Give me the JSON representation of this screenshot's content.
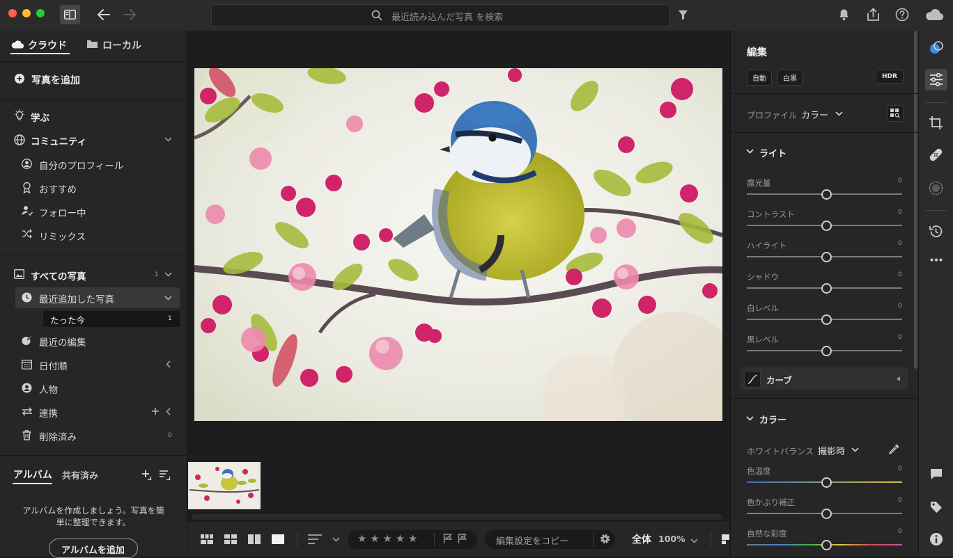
{
  "search": {
    "placeholder": "最近読み込んだ写真 を検索"
  },
  "sidebar": {
    "tabs": {
      "cloud": "クラウド",
      "local": "ローカル"
    },
    "add_photos": "写真を追加",
    "learn": "学ぶ",
    "community": "コミュニティ",
    "community_items": [
      "自分のプロフィール",
      "おすすめ",
      "フォロー中",
      "リミックス"
    ],
    "all_photos": {
      "label": "すべての写真",
      "count": "1"
    },
    "recent_added": "最近追加した写真",
    "just_now": {
      "label": "たった今",
      "count": "1"
    },
    "recent_edits": "最近の編集",
    "by_date": "日付順",
    "people": "人物",
    "integrations": "連携",
    "deleted": {
      "label": "削除済み",
      "count": "0"
    },
    "albums_tab": "アルバム",
    "shared_tab": "共有済み",
    "album_hint": "アルバムを作成しましょう。写真を簡単に整理できます。",
    "add_album": "アルバムを追加"
  },
  "bottombar": {
    "stars": "★ ★ ★ ★ ★",
    "copy_settings": "編集設定をコピー",
    "fit": "全体",
    "zoom": "100%"
  },
  "edit": {
    "title": "編集",
    "auto": "自動",
    "bw": "白黒",
    "hdr": "HDR",
    "profile_label": "プロファイル",
    "profile_value": "カラー",
    "light_section": "ライト",
    "light_sliders": [
      {
        "label": "露光量",
        "value": "0"
      },
      {
        "label": "コントラスト",
        "value": "0"
      },
      {
        "label": "ハイライト",
        "value": "0"
      },
      {
        "label": "シャドウ",
        "value": "0"
      },
      {
        "label": "白レベル",
        "value": "0"
      },
      {
        "label": "黒レベル",
        "value": "0"
      }
    ],
    "curve": "カーブ",
    "color_section": "カラー",
    "wb_label": "ホワイトバランス",
    "wb_value": "撮影時",
    "color_sliders": [
      {
        "label": "色温度",
        "value": "0"
      },
      {
        "label": "色かぶり補正",
        "value": "0"
      },
      {
        "label": "自然な彩度",
        "value": "0"
      }
    ]
  }
}
